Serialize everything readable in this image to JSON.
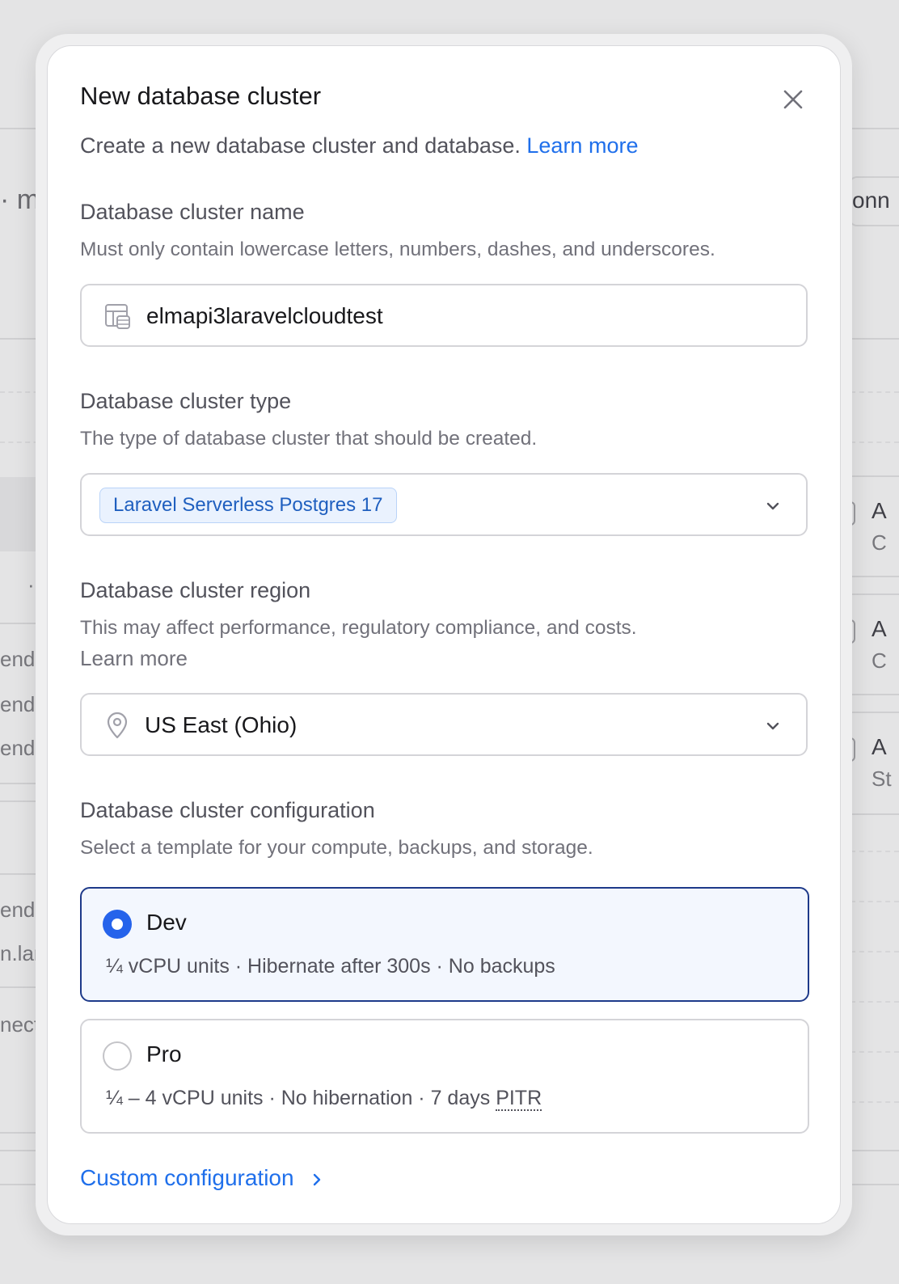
{
  "background": {
    "fragments": [
      "· m",
      "onn",
      "A",
      "C",
      "A",
      "C",
      "A",
      "St",
      "endi",
      "endi",
      "endi",
      "endi",
      "n.lar",
      "nect"
    ]
  },
  "modal": {
    "title": "New database cluster",
    "subtitle": "Create a new database cluster and database.",
    "subtitle_link": "Learn more",
    "close_icon": "close-icon",
    "name_section": {
      "label": "Database cluster name",
      "help": "Must only contain lowercase letters, numbers, dashes, and underscores.",
      "value": "elmapi3laravelcloudtest",
      "icon": "database-table-icon"
    },
    "type_section": {
      "label": "Database cluster type",
      "help": "The type of database cluster that should be created.",
      "selected": "Laravel Serverless Postgres 17"
    },
    "region_section": {
      "label": "Database cluster region",
      "help": "This may affect performance, regulatory compliance, and costs.",
      "help_link": "Learn more",
      "selected": "US East (Ohio)",
      "icon": "map-pin-icon"
    },
    "config_section": {
      "label": "Database cluster configuration",
      "help": "Select a template for your compute, backups, and storage.",
      "options": [
        {
          "name": "Dev",
          "desc": "¼ vCPU units · Hibernate after 300s · No backups",
          "selected": true
        },
        {
          "name": "Pro",
          "desc_prefix": "¼ – 4 vCPU units · No hibernation · 7 days ",
          "desc_abbr": "PITR",
          "selected": false
        }
      ],
      "custom_link": "Custom configuration"
    }
  },
  "colors": {
    "accent": "#2563eb",
    "link": "#1f6feb",
    "selected_border": "#1e3a8a"
  }
}
